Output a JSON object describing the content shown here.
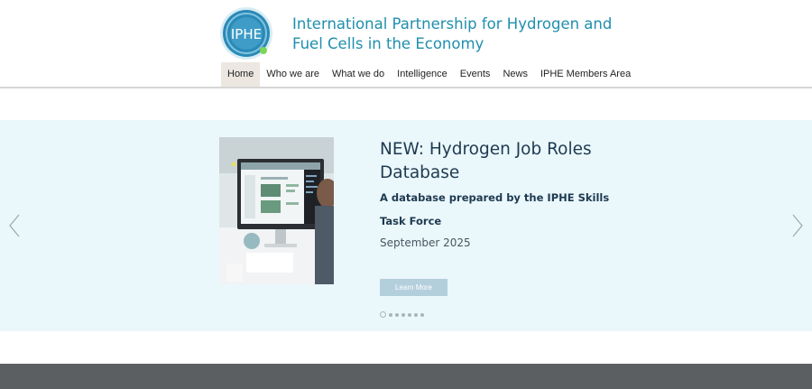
{
  "header": {
    "logo_text": "IPHE",
    "brand_title": "International Partnership for Hydrogen and Fuel Cells in the Economy"
  },
  "nav": {
    "items": [
      {
        "label": "Home",
        "active": true
      },
      {
        "label": "Who we are"
      },
      {
        "label": "What we do"
      },
      {
        "label": "Intelligence"
      },
      {
        "label": "Events"
      },
      {
        "label": "News"
      },
      {
        "label": "IPHE Members Area"
      }
    ]
  },
  "slider": {
    "title": "NEW: Hydrogen Job Roles Database",
    "subtitle": "A database prepared by the IPHE Skills Task Force",
    "date": "September 2025",
    "button_label": "Learn More",
    "slide_count": 7,
    "active_slide": 1
  },
  "colors": {
    "brand": "#1f8fae",
    "slider_bg": "#eaf7fb",
    "button_bg": "#b4cfdc",
    "footer_band": "#5b5f62",
    "nav_active_bg": "#ece8e1"
  }
}
